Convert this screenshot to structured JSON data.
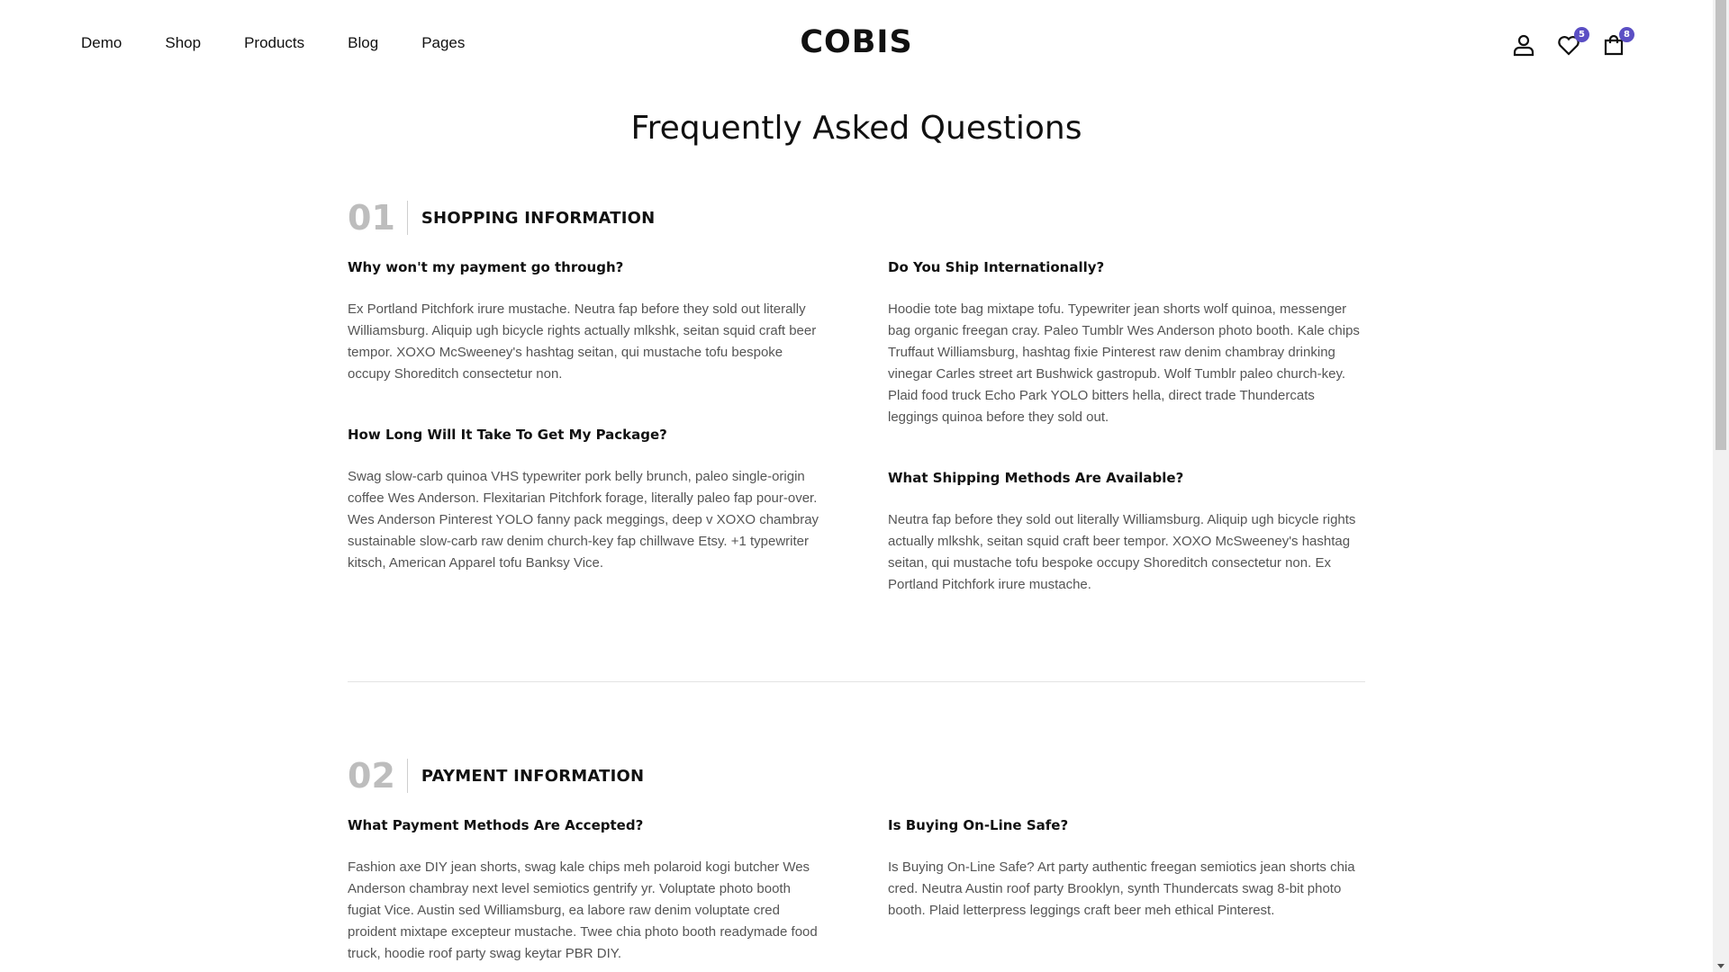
{
  "header": {
    "nav": [
      "Demo",
      "Shop",
      "Products",
      "Blog",
      "Pages"
    ],
    "logo": "COBIS",
    "wishlist_count": "5",
    "cart_count": "8",
    "icons": [
      "user-icon",
      "heart-icon",
      "cart-icon"
    ],
    "badge_color": "#5b4fc4"
  },
  "page": {
    "title": "Frequently Asked Questions"
  },
  "sections": [
    {
      "number": "01",
      "title": "SHOPPING INFORMATION",
      "questions": [
        {
          "q": "Why won't my payment go through?",
          "a": "Ex Portland Pitchfork irure mustache. Neutra fap before they sold out literally Williamsburg. Aliquip ugh bicycle rights actually mlkshk, seitan squid craft beer tempor. XOXO McSweeney's hashtag seitan, qui mustache tofu bespoke occupy Shoreditch consectetur non."
        },
        {
          "q": "Do You Ship Internationally?",
          "a": "Hoodie tote bag mixtape tofu. Typewriter jean shorts wolf quinoa, messenger bag organic freegan cray. Paleo Tumblr Wes Anderson photo booth. Kale chips Truffaut Williamsburg, hashtag fixie Pinterest raw denim chambray drinking vinegar Carles street art Bushwick gastropub. Wolf Tumblr paleo church-key. Plaid food truck Echo Park YOLO bitters hella, direct trade Thundercats leggings quinoa before they sold out."
        },
        {
          "q": "How Long Will It Take To Get My Package?",
          "a": "Swag slow-carb quinoa VHS typewriter pork belly brunch, paleo single-origin coffee Wes Anderson. Flexitarian Pitchfork forage, literally paleo fap pour-over. Wes Anderson Pinterest YOLO fanny pack meggings, deep v XOXO chambray sustainable slow-carb raw denim church-key fap chillwave Etsy. +1 typewriter kitsch, American Apparel tofu Banksy Vice."
        },
        {
          "q": "What Shipping Methods Are Available?",
          "a": "Neutra fap before they sold out literally Williamsburg. Aliquip ugh bicycle rights actually mlkshk, seitan squid craft beer tempor. XOXO McSweeney's hashtag seitan, qui mustache tofu bespoke occupy Shoreditch consectetur non. Ex Portland Pitchfork irure mustache."
        }
      ]
    },
    {
      "number": "02",
      "title": "PAYMENT INFORMATION",
      "questions": [
        {
          "q": "What Payment Methods Are Accepted?",
          "a": "Fashion axe DIY jean shorts, swag kale chips meh polaroid kogi butcher Wes Anderson chambray next level semiotics gentrify yr. Voluptate photo booth fugiat Vice. Austin sed Williamsburg, ea labore raw denim voluptate cred proident mixtape excepteur mustache. Twee chia photo booth readymade food truck, hoodie roof party swag keytar PBR DIY."
        },
        {
          "q": "Is Buying On-Line Safe?",
          "a": "Is Buying On-Line Safe? Art party authentic freegan semiotics jean shorts chia cred. Neutra Austin roof party Brooklyn, synth Thundercats swag 8-bit photo booth. Plaid letterpress leggings craft beer meh ethical Pinterest."
        }
      ]
    }
  ]
}
